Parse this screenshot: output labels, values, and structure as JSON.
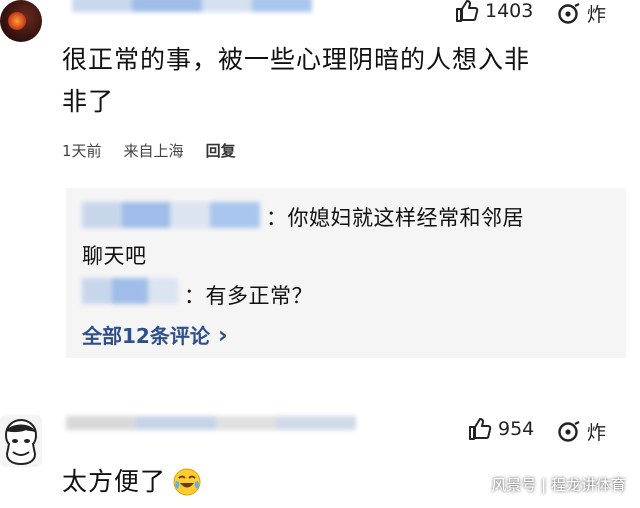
{
  "comments": [
    {
      "likes": "1403",
      "reaction": "炸",
      "text_line1": "很正常的事，被一些心理阴暗的人想入非",
      "text_line2": "非了",
      "time": "1天前",
      "location": "来自上海",
      "reply_label": "回复",
      "replies": [
        {
          "text_line1": "：你媳妇就这样经常和邻居",
          "text_line2": "聊天吧"
        },
        {
          "text_line1": "：有多正常？"
        }
      ],
      "all_replies_label": "全部12条评论",
      "all_replies_chevron": "›"
    },
    {
      "likes": "954",
      "reaction": "炸",
      "text": "太方便了",
      "emoji": "laughing-crying-emoji"
    }
  ],
  "watermark": "风景号 | 程龙讲体育",
  "colors": {
    "link": "#2f4e8c",
    "reply_bg": "#f5f5f5",
    "blur_blue": "#a9c6ee"
  }
}
